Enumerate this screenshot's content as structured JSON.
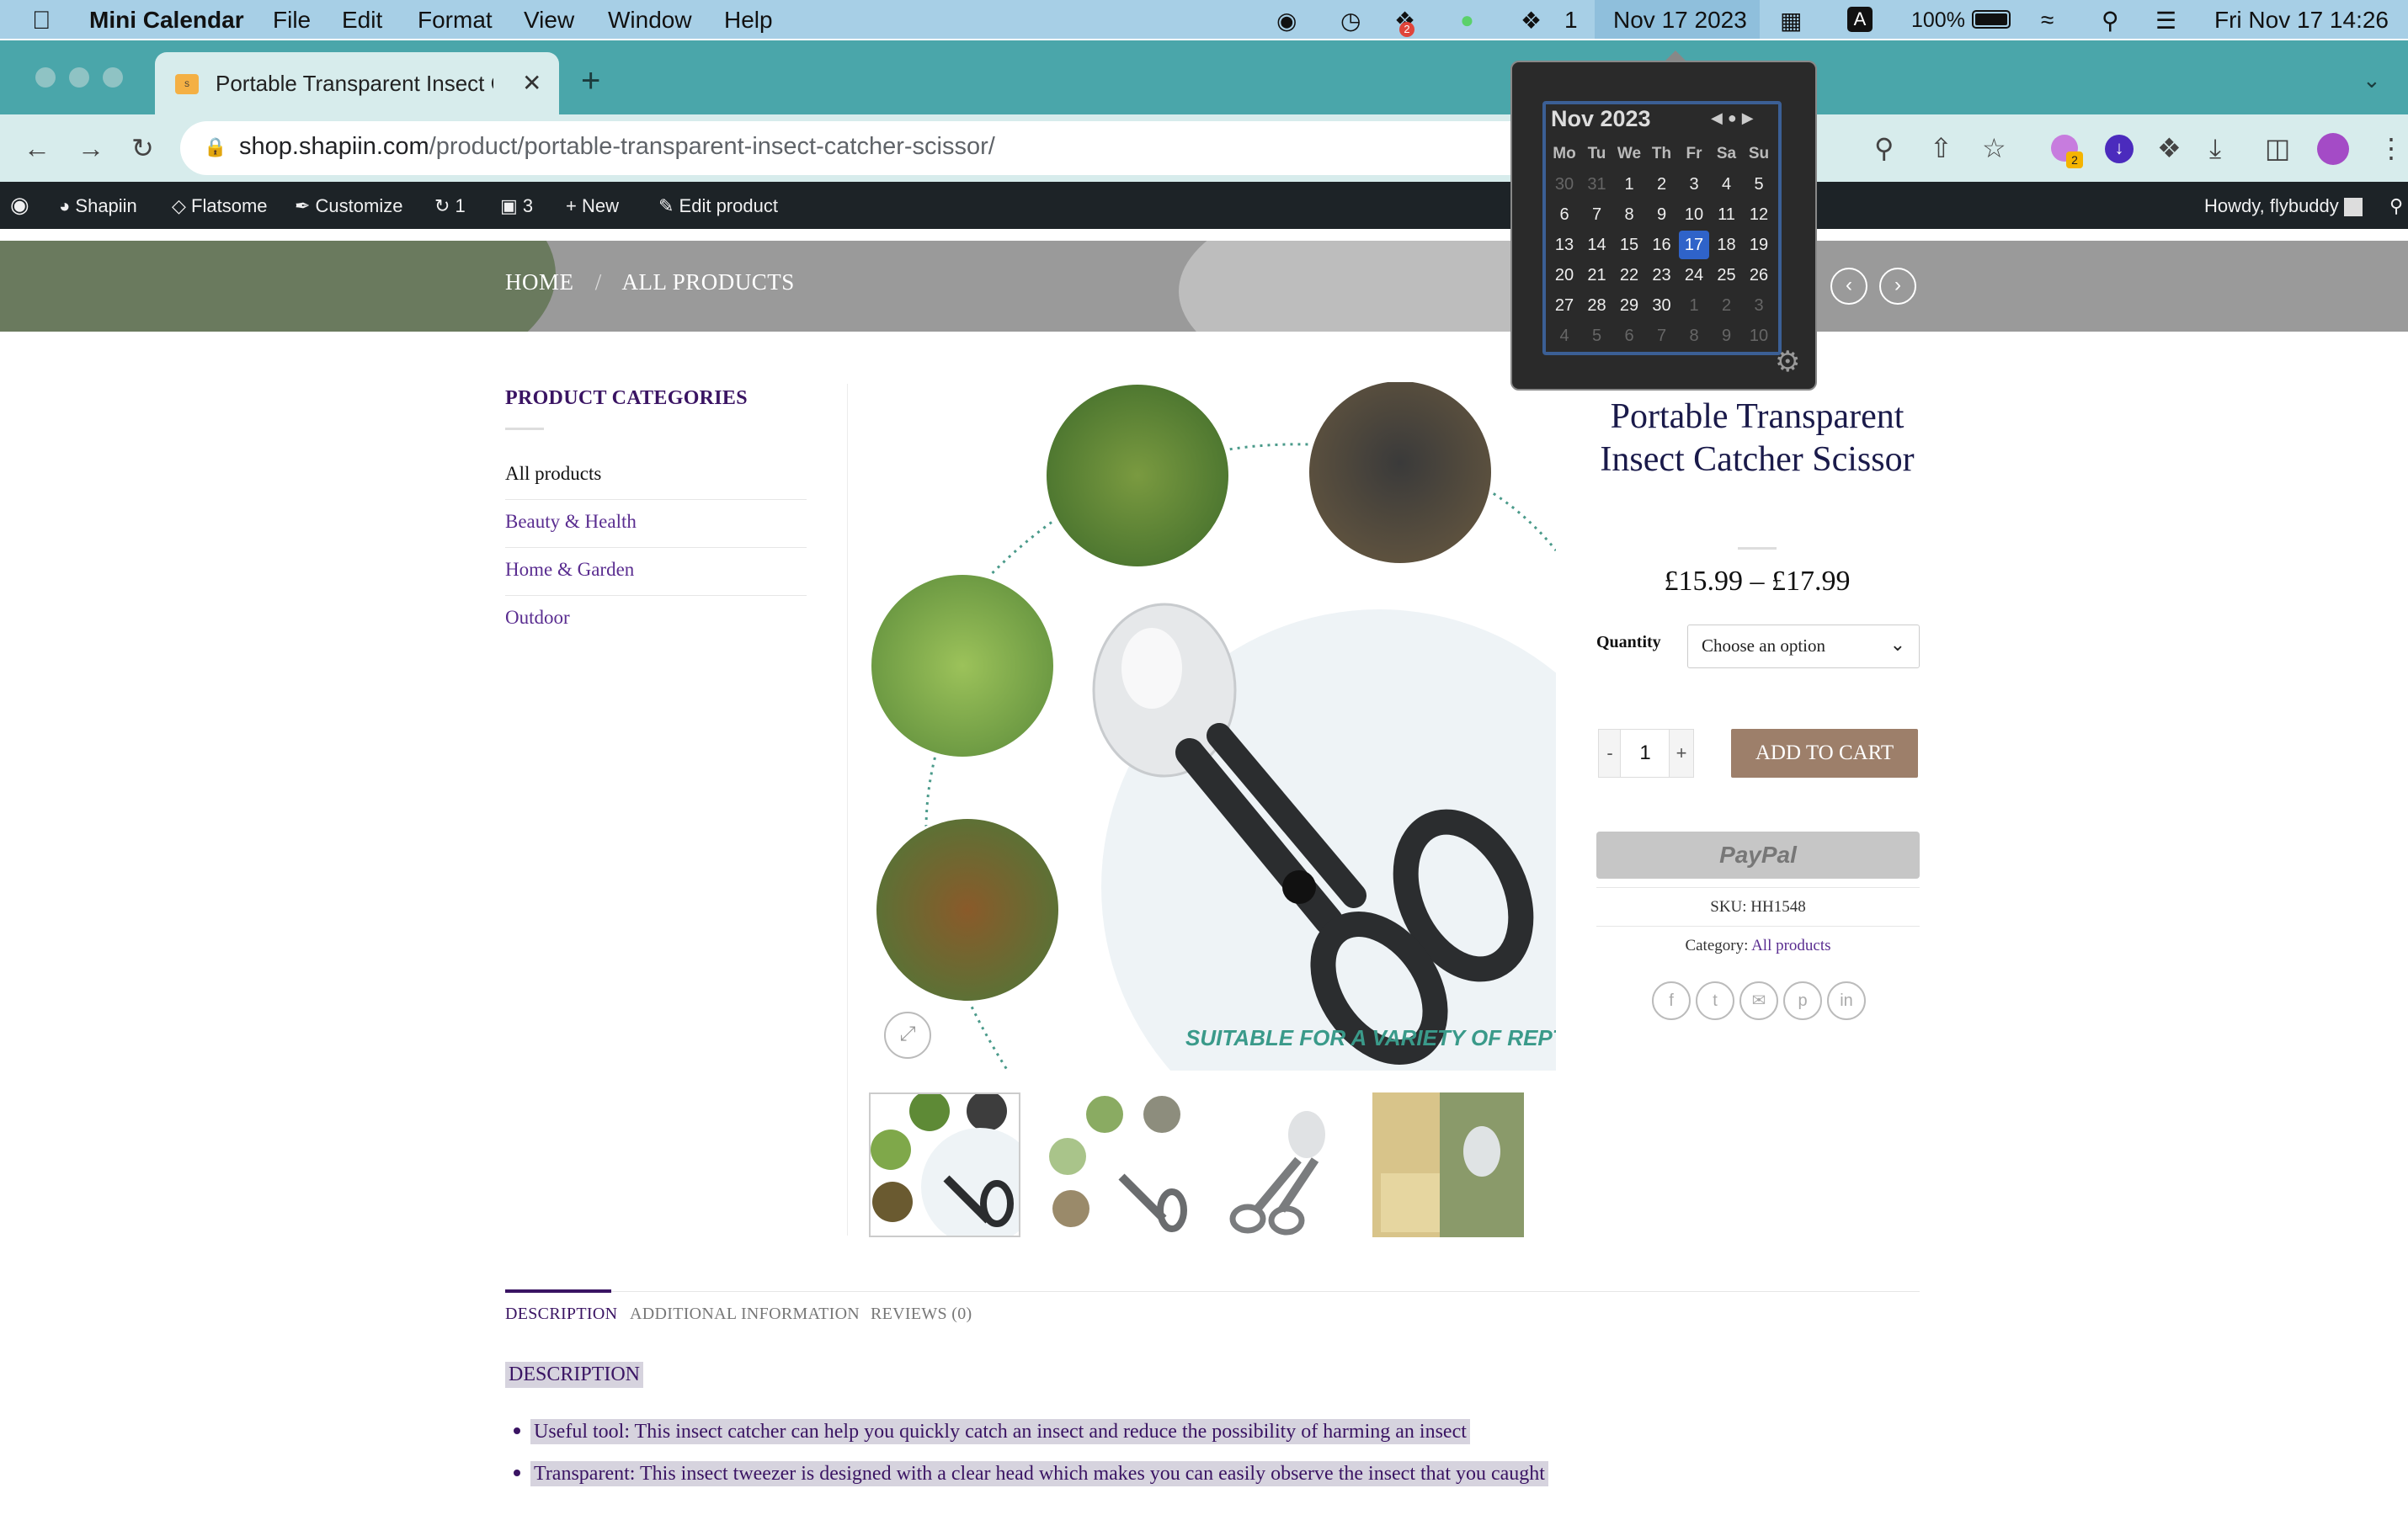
{
  "menubar": {
    "app_name": "Mini Calendar",
    "menus": [
      "File",
      "Edit",
      "Format",
      "View",
      "Window",
      "Help"
    ],
    "badge_count": "2",
    "wechat_count": "1",
    "calendar_date": "Nov 17 2023",
    "input_indicator": "A",
    "battery": "100%",
    "clock": "Fri Nov 17  14:26"
  },
  "browser": {
    "tab_title": "Portable Transparent Insect Catcher Scissor",
    "url_host": "shop.shapiin.com",
    "url_path": "/product/portable-transparent-insect-catcher-scissor/",
    "extension_badge": "2"
  },
  "adminbar": {
    "site": "Shapiin",
    "theme": "Flatsome",
    "customize": "Customize",
    "updates": "1",
    "comments": "3",
    "new": "New",
    "edit": "Edit product",
    "howdy": "Howdy, flybuddy"
  },
  "breadcrumb": {
    "home": "HOME",
    "sep": "/",
    "current": "ALL PRODUCTS"
  },
  "sidebar": {
    "title": "PRODUCT CATEGORIES",
    "items": [
      {
        "label": "All products"
      },
      {
        "label": "Beauty & Health"
      },
      {
        "label": "Home & Garden"
      },
      {
        "label": "Outdoor"
      }
    ]
  },
  "gallery": {
    "banner": "SUITABLE FOR A VARIETY OF REPTILES"
  },
  "product": {
    "title": "Portable Transparent Insect Catcher Scissor",
    "price": "£15.99 – £17.99",
    "quantity_label": "Quantity",
    "quantity_select": "Choose an option",
    "qty_minus": "-",
    "qty_value": "1",
    "qty_plus": "+",
    "add_to_cart": "ADD TO CART",
    "paypal": "PayPal",
    "sku": "SKU: HH1548",
    "category_label": "Category:",
    "category_value": "All products"
  },
  "tabs": {
    "description": "DESCRIPTION",
    "additional": "ADDITIONAL INFORMATION",
    "reviews": "REVIEWS (0)"
  },
  "description": {
    "heading": "DESCRIPTION",
    "bullets": [
      "Useful tool: This insect catcher can help you quickly catch an insect and reduce the possibility of harming an insect",
      "Transparent: This insect tweezer is designed with a clear head which makes you can easily observe the insect that you caught"
    ]
  },
  "calendar": {
    "title": "Nov 2023",
    "weekdays": [
      "Mo",
      "Tu",
      "We",
      "Th",
      "Fr",
      "Sa",
      "Su"
    ],
    "weeks": [
      [
        "30",
        "31",
        "1",
        "2",
        "3",
        "4",
        "5"
      ],
      [
        "6",
        "7",
        "8",
        "9",
        "10",
        "11",
        "12"
      ],
      [
        "13",
        "14",
        "15",
        "16",
        "17",
        "18",
        "19"
      ],
      [
        "20",
        "21",
        "22",
        "23",
        "24",
        "25",
        "26"
      ],
      [
        "27",
        "28",
        "29",
        "30",
        "1",
        "2",
        "3"
      ],
      [
        "4",
        "5",
        "6",
        "7",
        "8",
        "9",
        "10"
      ]
    ],
    "today": "17"
  },
  "colors": {
    "menubar": "#a7cfe6",
    "chrome_frame": "#4aa6aa",
    "admin_bar": "#1d2327",
    "brand_purple": "#3a1463",
    "add_to_cart": "#9d7f6a",
    "today_highlight": "#2f63c9"
  }
}
